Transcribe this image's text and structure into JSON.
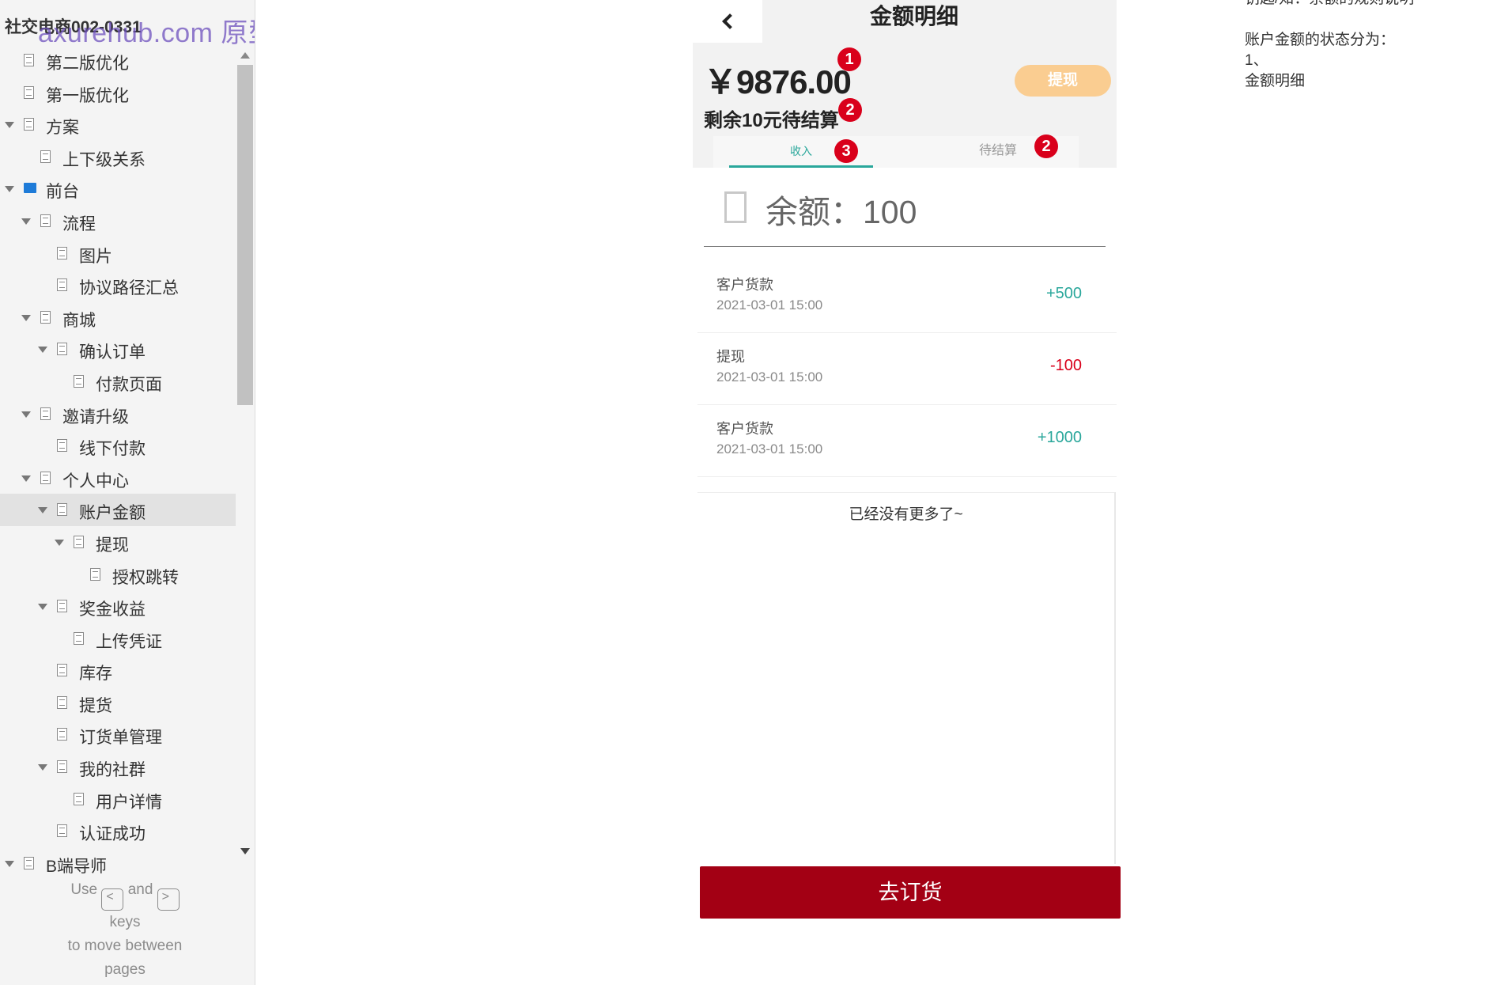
{
  "sidebar": {
    "project_title": "社交电商002-0331",
    "watermark": "axurehub.com 原型资源站",
    "items": [
      {
        "label": "第二版优化",
        "level": 1,
        "icon": "page-icon",
        "expanded": null
      },
      {
        "label": "第一版优化",
        "level": 1,
        "icon": "page-icon",
        "expanded": null
      },
      {
        "label": "方案",
        "level": 1,
        "icon": "page-icon",
        "expanded": true
      },
      {
        "label": "上下级关系",
        "level": 2,
        "icon": "page-icon",
        "expanded": null
      },
      {
        "label": "前台",
        "level": 1,
        "icon": "folder-icon",
        "expanded": true
      },
      {
        "label": "流程",
        "level": 2,
        "icon": "page-icon",
        "expanded": true
      },
      {
        "label": "图片",
        "level": 3,
        "icon": "page-icon",
        "expanded": null
      },
      {
        "label": "协议路径汇总",
        "level": 3,
        "icon": "page-icon",
        "expanded": null
      },
      {
        "label": "商城",
        "level": 2,
        "icon": "page-icon",
        "expanded": true
      },
      {
        "label": "确认订单",
        "level": 3,
        "icon": "page-icon",
        "expanded": true
      },
      {
        "label": "付款页面",
        "level": 4,
        "icon": "page-icon",
        "expanded": null
      },
      {
        "label": "邀请升级",
        "level": 2,
        "icon": "page-icon",
        "expanded": true
      },
      {
        "label": "线下付款",
        "level": 3,
        "icon": "page-icon",
        "expanded": null
      },
      {
        "label": "个人中心",
        "level": 2,
        "icon": "page-icon",
        "expanded": true
      },
      {
        "label": "账户金额",
        "level": 3,
        "icon": "page-icon",
        "expanded": true,
        "selected": true
      },
      {
        "label": "提现",
        "level": 4,
        "icon": "page-icon",
        "expanded": true
      },
      {
        "label": "授权跳转",
        "level": 5,
        "icon": "page-icon",
        "expanded": null
      },
      {
        "label": "奖金收益",
        "level": 3,
        "icon": "page-icon",
        "expanded": true
      },
      {
        "label": "上传凭证",
        "level": 4,
        "icon": "page-icon",
        "expanded": null
      },
      {
        "label": "库存",
        "level": 3,
        "icon": "page-icon",
        "expanded": null
      },
      {
        "label": "提货",
        "level": 3,
        "icon": "page-icon",
        "expanded": null
      },
      {
        "label": "订货单管理",
        "level": 3,
        "icon": "page-icon",
        "expanded": null
      },
      {
        "label": "我的社群",
        "level": 3,
        "icon": "page-icon",
        "expanded": true
      },
      {
        "label": "用户详情",
        "level": 4,
        "icon": "page-icon",
        "expanded": null
      },
      {
        "label": "认证成功",
        "level": 3,
        "icon": "page-icon",
        "expanded": null
      },
      {
        "label": "B端导师",
        "level": 1,
        "icon": "page-icon",
        "expanded": true
      }
    ],
    "key_hint": {
      "use": "Use",
      "and": "and",
      "keys": "keys",
      "line2": "to move between",
      "line3": "pages",
      "prev_key": "<",
      "next_key": ">"
    }
  },
  "phone": {
    "heading": "金额明细",
    "balance_amount": "￥9876.00",
    "withdraw_label": "提现",
    "pending_text": "剩余10元待结算",
    "tabs": {
      "income": "收入",
      "pending": "待结算"
    },
    "badges": {
      "balance": "1",
      "pending_text": "2",
      "income_tab": "3",
      "pending_tab": "2"
    },
    "balance_label": "余额：100",
    "records": [
      {
        "title": "客户货款",
        "time": "2021-03-01 15:00",
        "amount": "+500",
        "sign": "positive"
      },
      {
        "title": "提现",
        "time": "2021-03-01 15:00",
        "amount": "-100",
        "sign": "negative"
      },
      {
        "title": "客户货款",
        "time": "2021-03-01 15:00",
        "amount": "+1000",
        "sign": "positive"
      }
    ],
    "no_more": "已经没有更多了~",
    "order_button": "去订货"
  },
  "notes": {
    "line0": "钥匙/知：余额的规则说明",
    "line1": "账户金额的状态分为：",
    "line2": "1、",
    "line3": "金额明细"
  },
  "colors": {
    "accent_teal": "#2aa79b",
    "badge_red": "#d9001b",
    "order_button": "#a30014",
    "withdraw_button": "#facd91",
    "folder_blue": "#1e7bd8"
  }
}
